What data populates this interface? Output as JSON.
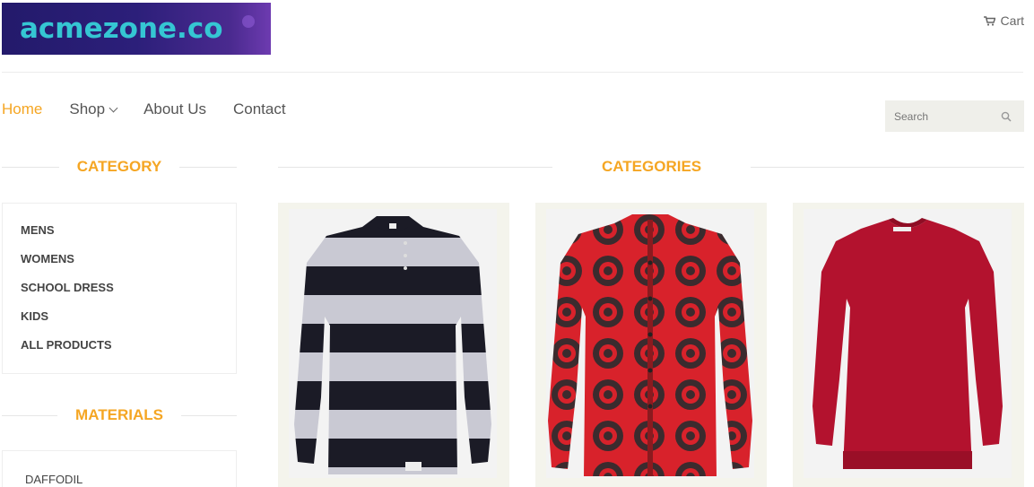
{
  "header": {
    "logo_text": "acmezone.co",
    "cart_label": "Cart"
  },
  "nav": {
    "items": [
      {
        "label": "Home",
        "active": true
      },
      {
        "label": "Shop",
        "has_dropdown": true
      },
      {
        "label": "About Us"
      },
      {
        "label": "Contact"
      }
    ]
  },
  "search": {
    "placeholder": "Search"
  },
  "sidebar": {
    "category_title": "CATEGORY",
    "categories": [
      "MENS",
      "WOMENS",
      "SCHOOL DRESS",
      "KIDS",
      "ALL PRODUCTS"
    ],
    "materials_title": "MATERIALS",
    "materials": [
      "DAFFODIL"
    ]
  },
  "main": {
    "title": "CATEGORIES",
    "products": [
      {
        "image": "black-white-striped-sweater"
      },
      {
        "image": "red-black-patterned-cardigan"
      },
      {
        "image": "red-sweater-dress"
      }
    ]
  },
  "colors": {
    "accent": "#f5a623",
    "logo_text": "#35c6d3",
    "logo_bg": "#2c1f7a"
  }
}
